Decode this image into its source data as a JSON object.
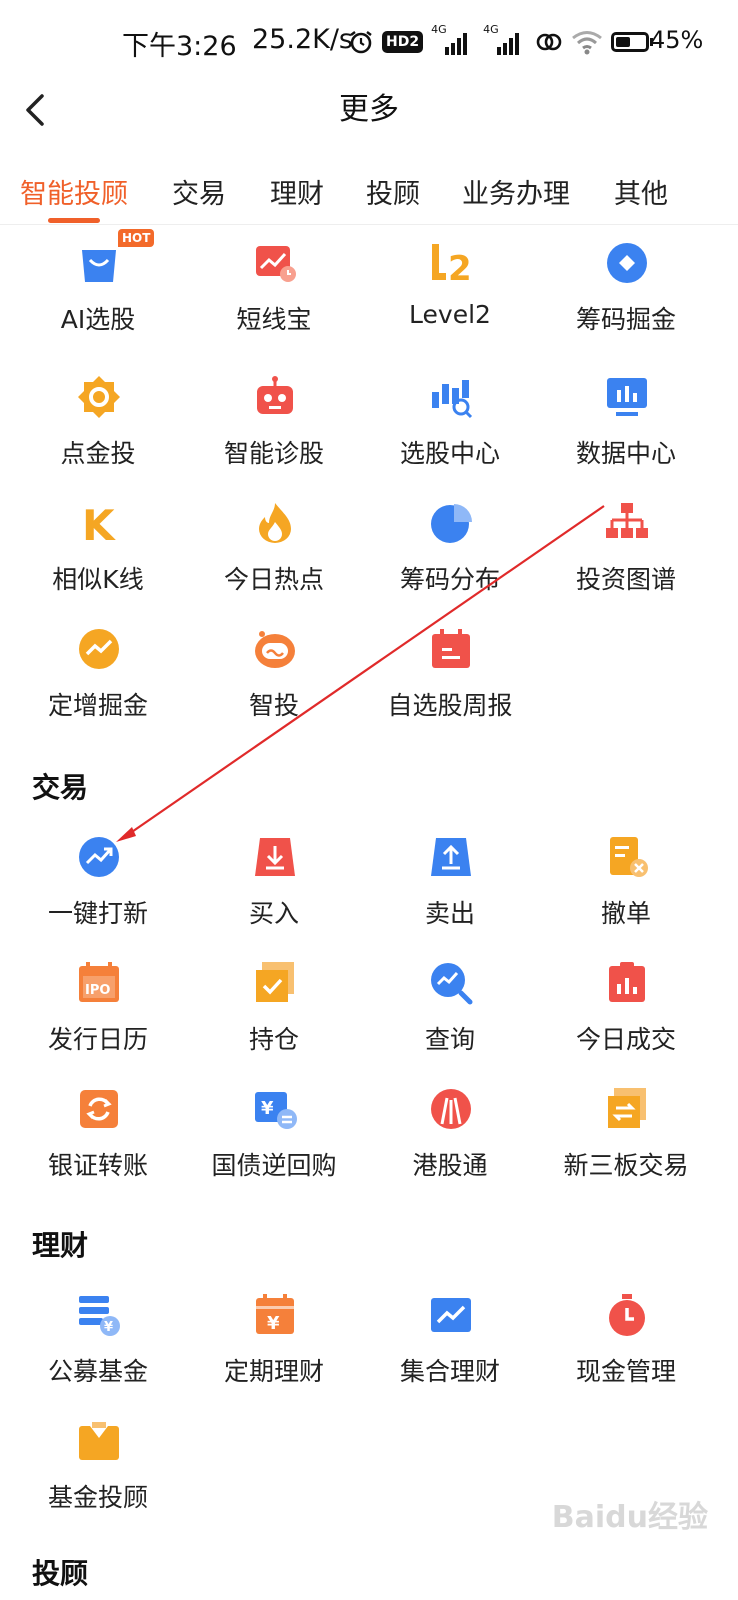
{
  "status_bar": {
    "time": "下午3:26",
    "speed": "25.2K/s",
    "hd": "HD2",
    "net1": "4G",
    "net2": "4G",
    "battery": "45%",
    "battery_level": 0.45
  },
  "nav": {
    "title": "更多"
  },
  "tabs": [
    "智能投顾",
    "交易",
    "理财",
    "投顾",
    "业务办理",
    "其他"
  ],
  "hot_badge": "HOT",
  "sections": {
    "trade": "交易",
    "finance": "理财",
    "advisor": "投顾"
  },
  "smart_items": [
    "AI选股",
    "短线宝",
    "Level2",
    "筹码掘金",
    "点金投",
    "智能诊股",
    "选股中心",
    "数据中心",
    "相似K线",
    "今日热点",
    "筹码分布",
    "投资图谱",
    "定增掘金",
    "智投",
    "自选股周报"
  ],
  "trade_items": [
    "一键打新",
    "买入",
    "卖出",
    "撤单",
    "发行日历",
    "持仓",
    "查询",
    "今日成交",
    "银证转账",
    "国债逆回购",
    "港股通",
    "新三板交易"
  ],
  "finance_items": [
    "公募基金",
    "定期理财",
    "集合理财",
    "现金管理",
    "基金投顾"
  ],
  "watermark": "Baidu经验"
}
